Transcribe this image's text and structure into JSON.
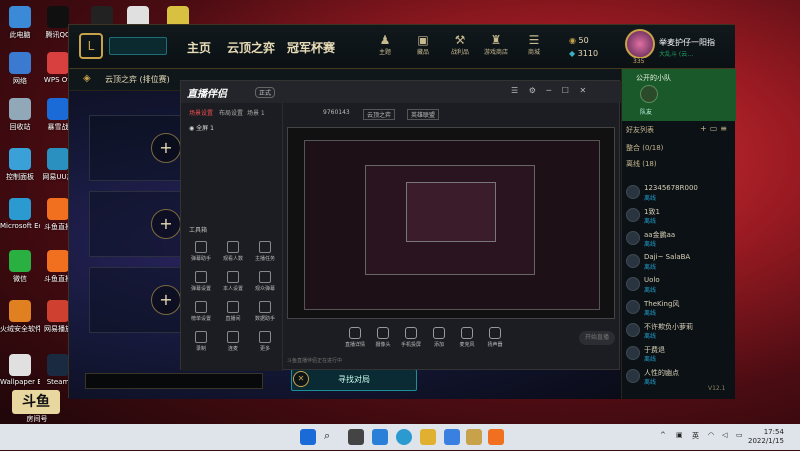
{
  "desktop": {
    "icons": [
      {
        "label": "此电脑",
        "color": "#3a8ad8"
      },
      {
        "label": "腾讯QQ",
        "color": "#101010"
      },
      {
        "label": "EPIC",
        "color": "#222222"
      },
      {
        "label": "",
        "color": "#e0e0e0"
      },
      {
        "label": "",
        "color": "#d8c040"
      },
      {
        "label": "网络",
        "color": "#3a7ad0"
      },
      {
        "label": "WPS Off",
        "color": "#d84040"
      },
      {
        "label": "回收站",
        "color": "#90a8b8"
      },
      {
        "label": "暴雪战",
        "color": "#1a6ad8"
      },
      {
        "label": "控制面板",
        "color": "#3aa0d8"
      },
      {
        "label": "网易UU加",
        "color": "#2a90c0"
      },
      {
        "label": "Microsoft Edge",
        "color": "#2a9ad0"
      },
      {
        "label": "斗鱼直播",
        "color": "#f07020"
      },
      {
        "label": "微信",
        "color": "#2ab040"
      },
      {
        "label": "斗鱼直播",
        "color": "#f07020"
      },
      {
        "label": "火绒安全软件",
        "color": "#e08020"
      },
      {
        "label": "网易播放",
        "color": "#d04030"
      },
      {
        "label": "Wallpaper Engine",
        "color": "#e0e0e0"
      },
      {
        "label": "Steam",
        "color": "#1a2a40"
      }
    ]
  },
  "lol": {
    "nav": [
      "主页",
      "云顶之弈",
      "冠军杯赛"
    ],
    "top_icons": [
      "主题",
      "藏品",
      "战利品",
      "游戏商店",
      "商城"
    ],
    "currency": {
      "blue_essence": "50",
      "rp": "3110"
    },
    "profile": {
      "name": "举麦护仔一阳指",
      "status": "大乱斗 (云…",
      "level": "335"
    },
    "subtitle": "云顶之弈 (排位赛)",
    "find_match": "寻找对局",
    "version": "V12.1",
    "friends": {
      "party_label": "公开的小队",
      "party_sub": "队友",
      "section_label": "好友列表",
      "groups": [
        {
          "name": "整合 (0/18)"
        },
        {
          "name": "离线 (18)"
        }
      ],
      "items": [
        {
          "name": "12345678R000",
          "status": "离线"
        },
        {
          "name": "1致1",
          "status": "离线"
        },
        {
          "name": "aa金鹏aa",
          "status": "离线"
        },
        {
          "name": "Daji~ SalaBA",
          "status": "离线"
        },
        {
          "name": "Uolo",
          "status": "离线"
        },
        {
          "name": "TheKing风",
          "status": "离线"
        },
        {
          "name": "不许欺负小萝莉",
          "status": "离线"
        },
        {
          "name": "于费退",
          "status": "离线"
        },
        {
          "name": "人性的幽点",
          "status": "离线"
        }
      ]
    }
  },
  "streamer": {
    "logo": "直播伴侣",
    "badge": "正式",
    "title_id": "9760143",
    "tabs": [
      "场景设置",
      "布局设置",
      "场景 1"
    ],
    "source_item": "全屏 1",
    "tools_label": "工具箱",
    "tools": [
      "弹幕助手",
      "观看人数",
      "主播任务",
      "弹幕设置",
      "本人设置",
      "观众弹幕",
      "榜单设置",
      "直播间",
      "数据助手",
      "录制",
      "连麦",
      "更多"
    ],
    "controls": [
      "直播详情",
      "摄像头",
      "手机投屏",
      "添加",
      "麦克风",
      "扬声器"
    ],
    "live_button": "开始直播",
    "header_items": [
      "9760143",
      "云顶之弈",
      "英雄联盟"
    ],
    "status_bar": "斗鱼直播伴侣正在进行中"
  },
  "watermark": {
    "badge": "斗鱼",
    "text": "房间号"
  },
  "taskbar": {
    "lang": "英",
    "time": "17:54",
    "date": "2022/1/15"
  }
}
